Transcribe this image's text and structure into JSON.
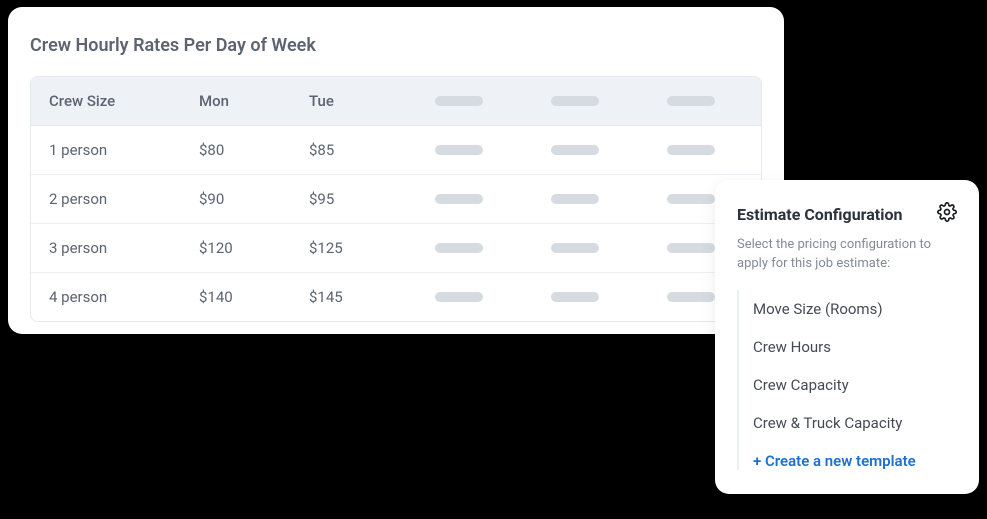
{
  "rates": {
    "title": "Crew Hourly Rates Per Day of Week",
    "columns": {
      "size": "Crew Size",
      "mon": "Mon",
      "tue": "Tue"
    },
    "rows": [
      {
        "size": "1 person",
        "mon": "$80",
        "tue": "$85"
      },
      {
        "size": "2 person",
        "mon": "$90",
        "tue": "$95"
      },
      {
        "size": "3 person",
        "mon": "$120",
        "tue": "$125"
      },
      {
        "size": "4 person",
        "mon": "$140",
        "tue": "$145"
      }
    ]
  },
  "config": {
    "title": "Estimate Configuration",
    "description": "Select the pricing configuration to apply for this job estimate:",
    "options": [
      "Move Size (Rooms)",
      "Crew Hours",
      "Crew Capacity",
      "Crew & Truck Capacity"
    ],
    "create_label": "+ Create a new template"
  }
}
